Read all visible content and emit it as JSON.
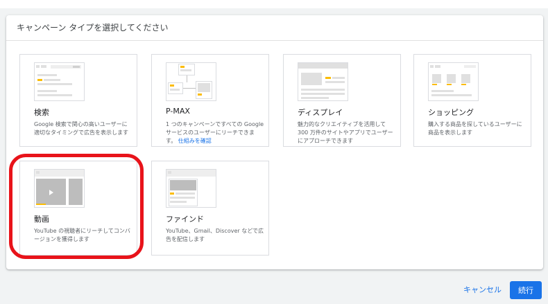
{
  "dialog": {
    "title": "キャンペーン タイプを選択してください"
  },
  "campaign_types": [
    {
      "title": "検索",
      "description": "Google 検索で関心の高いユーザーに適切なタイミングで広告を表示します"
    },
    {
      "title": "P-MAX",
      "description": "1 つのキャンペーンですべての Google サービスのユーザーにリーチできます。",
      "link": "仕組みを確認"
    },
    {
      "title": "ディスプレイ",
      "description": "魅力的なクリエイティブを活用して 300 万件のサイトやアプリでユーザーにアプローチできます"
    },
    {
      "title": "ショッピング",
      "description": "購入する商品を探しているユーザーに商品を表示します"
    },
    {
      "title": "動画",
      "description": "YouTube の視聴者にリーチしてコンバージョンを獲得します"
    },
    {
      "title": "ファインド",
      "description": "YouTube、Gmail、Discover などで広告を配信します"
    }
  ],
  "footer": {
    "cancel_label": "キャンセル",
    "continue_label": "続行"
  },
  "colors": {
    "accent": "#1a73e8",
    "highlight": "#e8131a",
    "illustration_yellow": "#fbbc04"
  }
}
